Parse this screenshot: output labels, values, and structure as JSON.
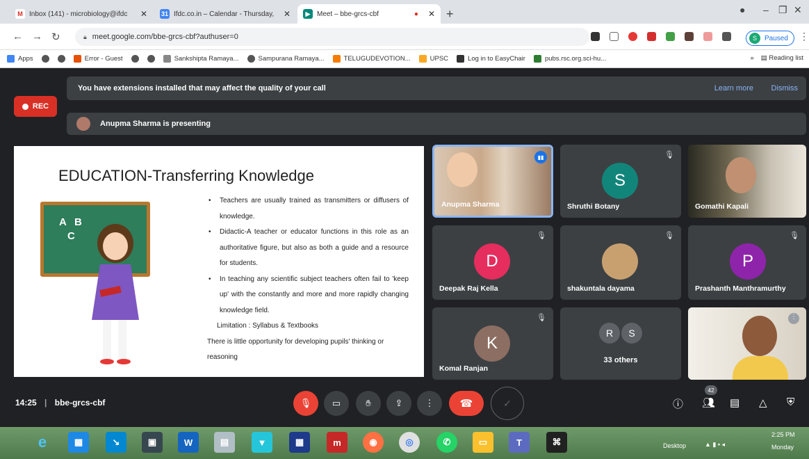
{
  "browser": {
    "tabs": [
      {
        "title": "Inbox (141) - microbiology@ifdc",
        "icon": "gmail-icon"
      },
      {
        "title": "Ifdc.co.in – Calendar - Thursday,",
        "icon": "calendar-icon"
      },
      {
        "title": "Meet – bbe-grcs-cbf",
        "icon": "meet-icon"
      }
    ],
    "url": "meet.google.com/bbe-grcs-cbf?authuser=0",
    "profile_label": "Paused",
    "profile_initial": "S",
    "bookmarks": [
      "Apps",
      "Error - Guest",
      "Sankshipta Ramaya...",
      "Sampurana Ramaya...",
      "TELUGUDEVOTION...",
      "UPSC",
      "Log in to EasyChair",
      "pubs.rsc.org.sci-hu..."
    ],
    "reading_list": "Reading list",
    "more_bookmarks": "»"
  },
  "meet": {
    "banner_text": "You have extensions installed that may affect the quality of your call",
    "banner_learn": "Learn more",
    "banner_dismiss": "Dismiss",
    "rec_label": "REC",
    "presenting_text": "Anupma Sharma is presenting",
    "slide": {
      "title": "EDUCATION-Transferring Knowledge",
      "bullets": [
        "Teachers are usually trained as transmitters or diffusers of knowledge.",
        "Didactic-A teacher or educator functions in this role as an authoritative figure, but also as both a guide and a resource for students.",
        "In teaching any scientific subject teachers often fail to 'keep up' with the constantly and more and more rapidly changing knowledge field."
      ],
      "limitation": "Limitation : Syllabus & Textbooks",
      "closing": "There is little opportunity for developing pupils' thinking or reasoning",
      "board_letters": [
        "A",
        "B",
        "C"
      ]
    },
    "participants": [
      {
        "name": "Anupma Sharma",
        "type": "video"
      },
      {
        "name": "Shruthi Botany",
        "initial": "S",
        "color": "#12857a"
      },
      {
        "name": "Gomathi Kapali",
        "type": "video"
      },
      {
        "name": "Deepak Raj Kella",
        "initial": "D",
        "color": "#e52d5e"
      },
      {
        "name": "shakuntala dayama",
        "type": "photo"
      },
      {
        "name": "Prashanth Manthramurthy",
        "initial": "P",
        "color": "#8e24aa"
      },
      {
        "name": "Komal Ranjan",
        "initial": "K",
        "color": "#8d6e63"
      },
      {
        "name": "33 others",
        "initials": [
          "R",
          "S"
        ]
      },
      {
        "name": "",
        "type": "video"
      }
    ],
    "time": "14:25",
    "meeting_code": "bbe-grcs-cbf",
    "people_count": "42"
  },
  "taskbar": {
    "desktop_label": "Desktop",
    "clock": "2:25 PM",
    "day": "Monday"
  }
}
